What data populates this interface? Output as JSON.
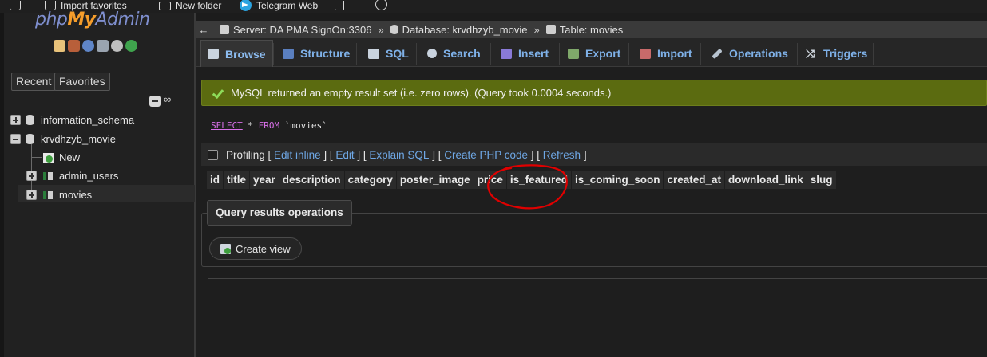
{
  "bookmarks": {
    "import_label": "Import favorites",
    "folder_label": "New folder",
    "telegram_label": "Telegram Web"
  },
  "sidebar": {
    "logo": {
      "php": "php",
      "my": "My",
      "admin": "Admin"
    },
    "recent_label": "Recent",
    "favorites_label": "Favorites",
    "link_symbol": "∞",
    "tree": {
      "db1": "information_schema",
      "db2": "krvdhzyb_movie",
      "new": "New",
      "table1": "admin_users",
      "table2": "movies"
    }
  },
  "breadcrumb": {
    "back": "←",
    "server": "Server: DA PMA SignOn:3306",
    "database": "Database: krvdhzyb_movie",
    "table": "Table: movies",
    "sep": "»"
  },
  "tabs": [
    "Browse",
    "Structure",
    "SQL",
    "Search",
    "Insert",
    "Export",
    "Import",
    "Operations",
    "Triggers"
  ],
  "message": "MySQL returned an empty result set (i.e. zero rows). (Query took 0.0004 seconds.)",
  "query": {
    "select": "SELECT",
    "star": "*",
    "from": "FROM",
    "table": "`movies`"
  },
  "profiling": {
    "label": "Profiling",
    "edit_inline": "Edit inline",
    "edit": "Edit",
    "explain": "Explain SQL",
    "create_php": "Create PHP code",
    "refresh": "Refresh"
  },
  "columns": [
    "id",
    "title",
    "year",
    "description",
    "category",
    "poster_image",
    "price",
    "is_featured",
    "is_coming_soon",
    "created_at",
    "download_link",
    "slug"
  ],
  "query_results_operations": {
    "title": "Query results operations",
    "create_view": "Create view"
  },
  "colors": {
    "success_bg": "#5b6b10",
    "link": "#6fa8e6",
    "annotation": "#e00000"
  }
}
